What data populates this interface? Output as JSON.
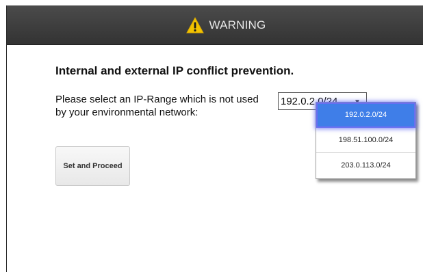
{
  "title_bar": {
    "icon": "warning-triangle-icon",
    "title": "WARNING",
    "icon_color": "#f2c200"
  },
  "main": {
    "heading": "Internal and external IP conflict prevention.",
    "prompt": "Please select an IP-Range which is not used by your environmental network:",
    "proceed_button_label": "Set and Proceed"
  },
  "ip_range_select": {
    "value": "192.0.2.0/24",
    "options": [
      {
        "label": "192.0.2.0/24",
        "selected": true
      },
      {
        "label": "198.51.100.0/24",
        "selected": false
      },
      {
        "label": "203.0.113.0/24",
        "selected": false
      }
    ],
    "highlight_color": "#3f7ee8"
  }
}
